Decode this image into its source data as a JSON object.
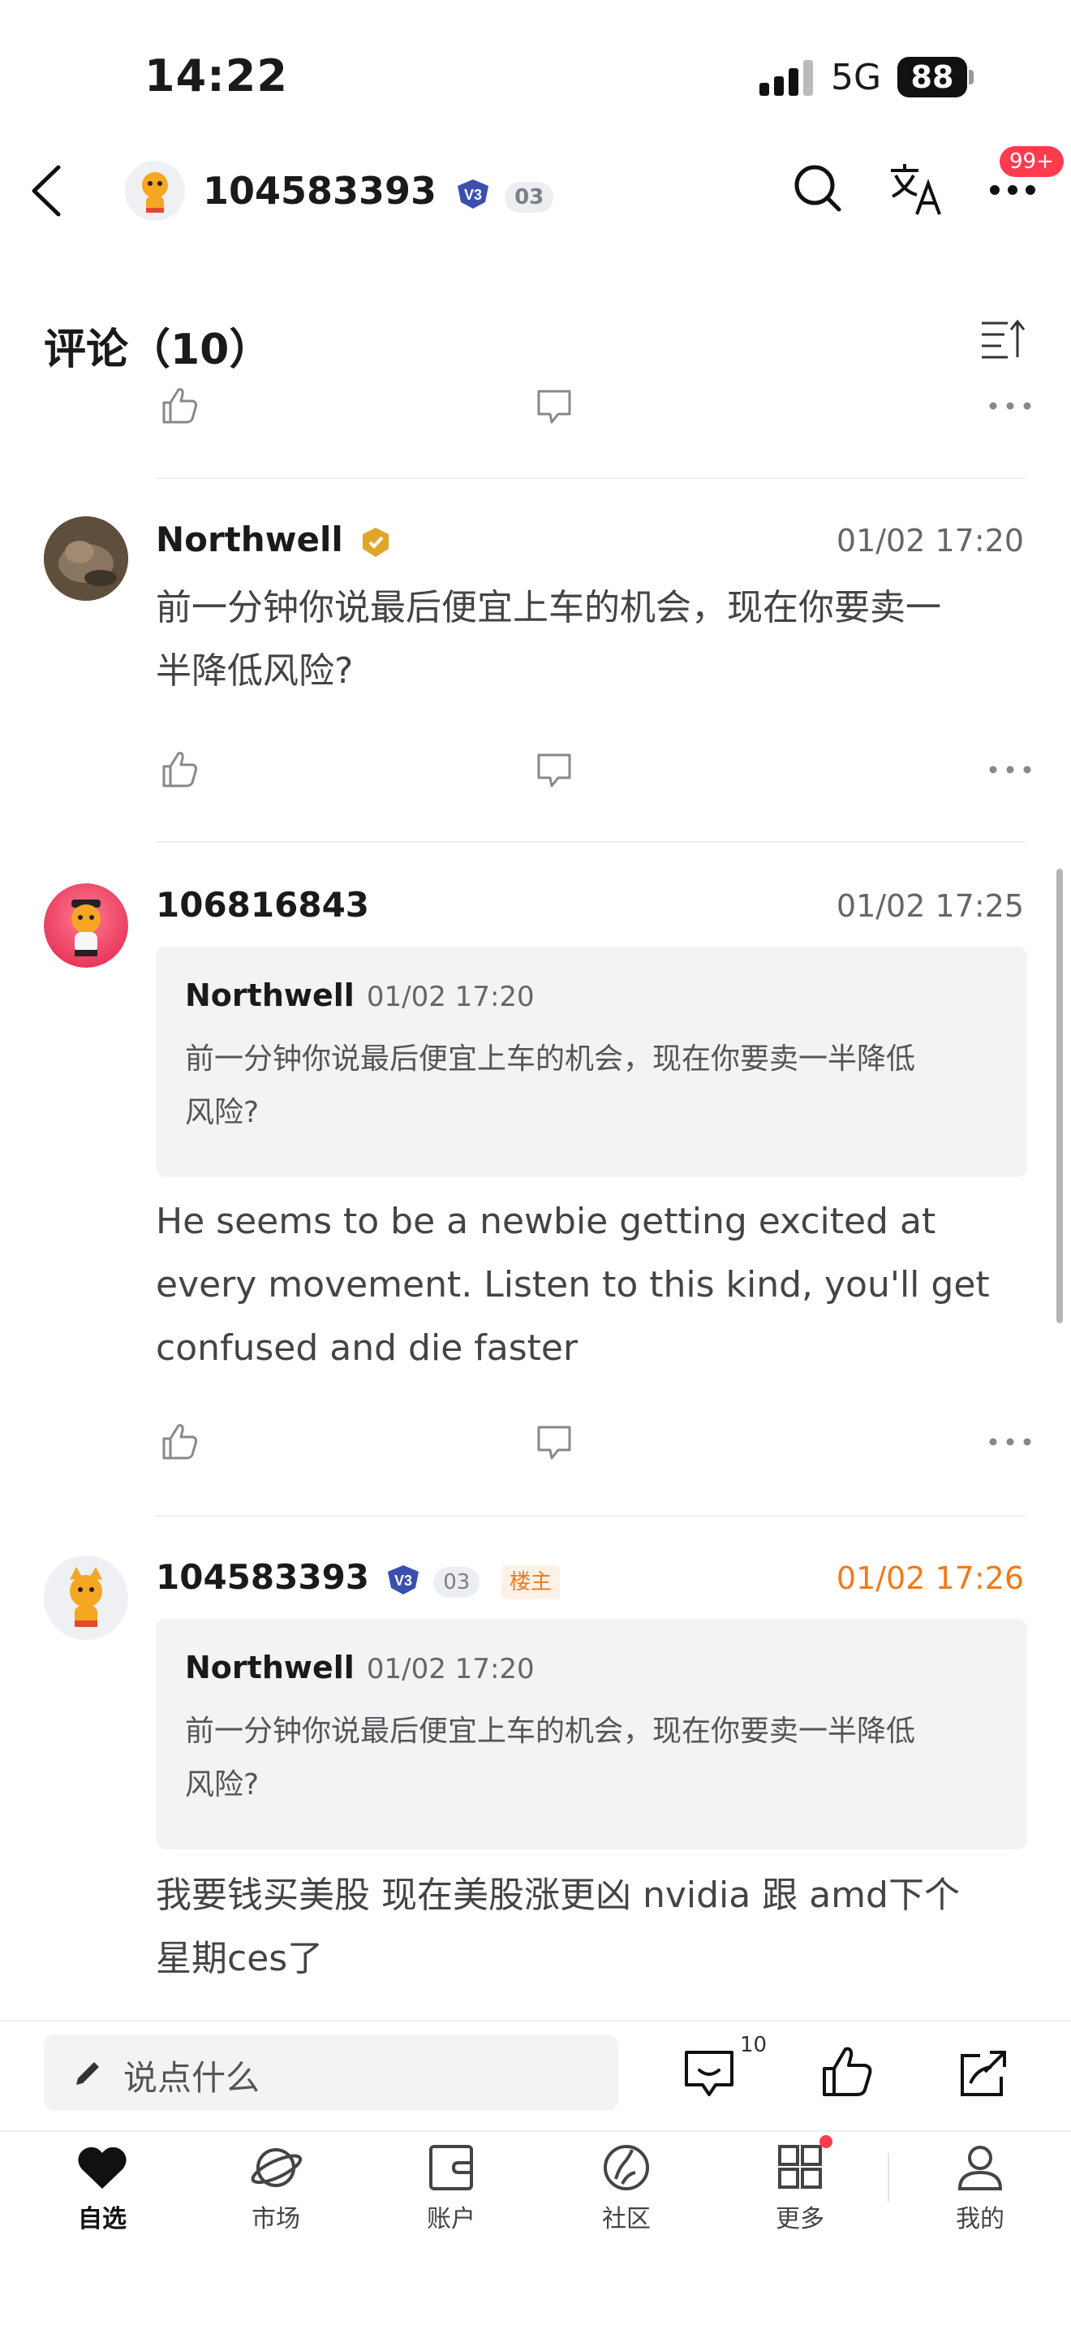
{
  "status_bar": {
    "time": "14:22",
    "network": "5G",
    "battery": "88"
  },
  "header": {
    "username": "104583393",
    "vip_badge": "V3",
    "level": "03",
    "notification_badge": "99+",
    "icons": [
      "back-icon",
      "search-icon",
      "translate-icon",
      "more-icon"
    ]
  },
  "comments_section": {
    "title": "评论（10）"
  },
  "comments": [
    {
      "user": "Northwell",
      "time": "01/02 17:20",
      "body_lines": [
        "前一分钟你说最后便宜上车的机会，现在你要卖一",
        "半降低风险?"
      ]
    },
    {
      "user": "106816843",
      "time": "01/02 17:25",
      "quote": {
        "user": "Northwell",
        "time": "01/02 17:20",
        "lines": [
          "前一分钟你说最后便宜上车的机会，现在你要卖一半降低",
          "风险?"
        ]
      },
      "body_lines": [
        "He seems to be a newbie getting excited at",
        "every movement. Listen to this kind, you'll get",
        "confused and die faster"
      ]
    },
    {
      "user": "104583393",
      "vip_badge": "V3",
      "level": "03",
      "owner_tag": "楼主",
      "time": "01/02 17:26",
      "quote": {
        "user": "Northwell",
        "time": "01/02 17:20",
        "lines": [
          "前一分钟你说最后便宜上车的机会，现在你要卖一半降低",
          "风险?"
        ]
      },
      "body_lines": [
        "我要钱买美股 现在美股涨更凶 nvidia 跟 amd下个",
        "星期ces了"
      ]
    }
  ],
  "bottom_bar": {
    "input_placeholder": "说点什么",
    "comment_count": "10"
  },
  "tab_bar": {
    "tabs": [
      {
        "label": "自选",
        "icon": "heart-icon",
        "active": true
      },
      {
        "label": "市场",
        "icon": "planet-icon",
        "active": false
      },
      {
        "label": "账户",
        "icon": "wallet-icon",
        "active": false
      },
      {
        "label": "社区",
        "icon": "community-icon",
        "active": false
      },
      {
        "label": "更多",
        "icon": "grid-icon",
        "active": false
      },
      {
        "label": "我的",
        "icon": "person-icon",
        "active": false
      }
    ]
  },
  "colors": {
    "accent_orange": "#f07a1a",
    "badge_red": "#ff3b4e",
    "quote_bg": "#f2f3f5"
  }
}
